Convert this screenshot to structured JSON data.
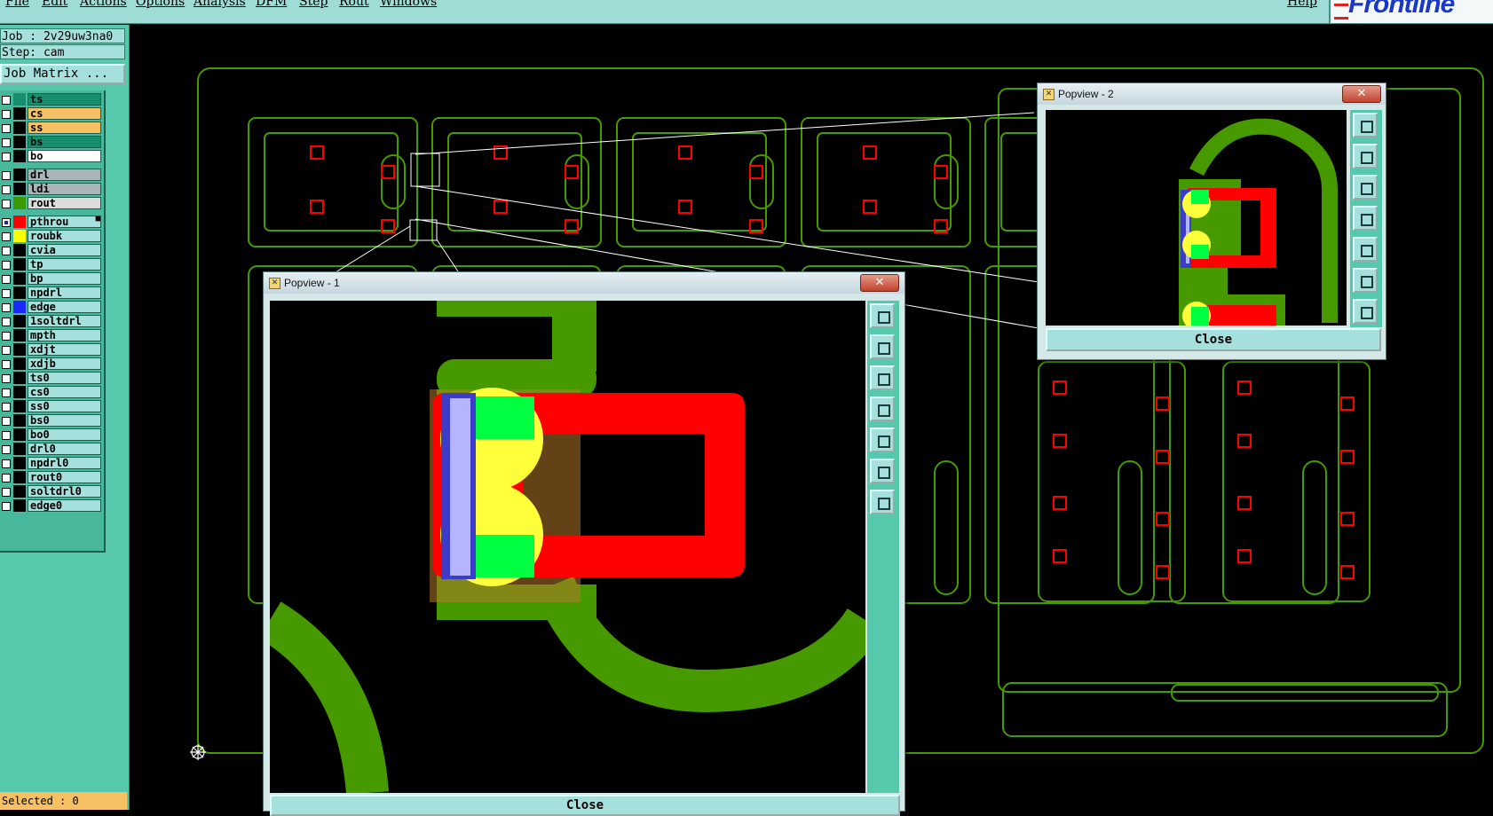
{
  "menubar": {
    "items": [
      "File",
      "Edit",
      "Actions",
      "Options",
      "Analysis",
      "DFM",
      "Step",
      "Rout",
      "Windows"
    ],
    "help": "Help",
    "logo": "Frontline"
  },
  "left_panel": {
    "job": "Job : 2v29uw3na0",
    "step": "Step: cam",
    "job_matrix_button": "Job Matrix ...",
    "selected": "Selected : 0",
    "layers": [
      {
        "name": "ts",
        "color": "#178f6e",
        "bg": "#178f6e",
        "checked": false
      },
      {
        "name": "cs",
        "color": "#000000",
        "bg": "#f7c063",
        "checked": false
      },
      {
        "name": "ss",
        "color": "#000000",
        "bg": "#f7c063",
        "checked": false
      },
      {
        "name": "bs",
        "color": "#000000",
        "bg": "#178f6e",
        "checked": false
      },
      {
        "name": "bo",
        "color": "#000000",
        "bg": "#ffffff",
        "checked": false
      },
      {
        "name": "drl",
        "color": "#000000",
        "bg": "#a8b4b8",
        "checked": false,
        "gap": true
      },
      {
        "name": "ldi",
        "color": "#000000",
        "bg": "#a8b4b8",
        "checked": false
      },
      {
        "name": "rout",
        "color": "#3a9a00",
        "bg": "#dcdcdc",
        "checked": false
      },
      {
        "name": "pthrou",
        "color": "#ff0000",
        "bg": "#a6e0dc",
        "checked": true,
        "mark": "■",
        "gap": true
      },
      {
        "name": "roubk",
        "color": "#ffff00",
        "bg": "#a6e0dc",
        "checked": false
      },
      {
        "name": "cvia",
        "color": "#000000",
        "bg": "#a6e0dc",
        "checked": false
      },
      {
        "name": "tp",
        "color": "#000000",
        "bg": "#a6e0dc",
        "checked": false
      },
      {
        "name": "bp",
        "color": "#000000",
        "bg": "#a6e0dc",
        "checked": false
      },
      {
        "name": "npdrl",
        "color": "#000000",
        "bg": "#a6e0dc",
        "checked": false
      },
      {
        "name": "edge",
        "color": "#1a2aff",
        "bg": "#a6e0dc",
        "checked": false
      },
      {
        "name": "1soltdrl",
        "color": "#000000",
        "bg": "#a6e0dc",
        "checked": false
      },
      {
        "name": "mpth",
        "color": "#000000",
        "bg": "#a6e0dc",
        "checked": false
      },
      {
        "name": "xdjt",
        "color": "#000000",
        "bg": "#a6e0dc",
        "checked": false
      },
      {
        "name": "xdjb",
        "color": "#000000",
        "bg": "#a6e0dc",
        "checked": false
      },
      {
        "name": "ts0",
        "color": "#000000",
        "bg": "#a6e0dc",
        "checked": false
      },
      {
        "name": "cs0",
        "color": "#000000",
        "bg": "#a6e0dc",
        "checked": false
      },
      {
        "name": "ss0",
        "color": "#000000",
        "bg": "#a6e0dc",
        "checked": false
      },
      {
        "name": "bs0",
        "color": "#000000",
        "bg": "#a6e0dc",
        "checked": false
      },
      {
        "name": "bo0",
        "color": "#000000",
        "bg": "#a6e0dc",
        "checked": false
      },
      {
        "name": "drl0",
        "color": "#000000",
        "bg": "#a6e0dc",
        "checked": false
      },
      {
        "name": "npdrl0",
        "color": "#000000",
        "bg": "#a6e0dc",
        "checked": false
      },
      {
        "name": "rout0",
        "color": "#000000",
        "bg": "#a6e0dc",
        "checked": false
      },
      {
        "name": "soltdrl0",
        "color": "#000000",
        "bg": "#a6e0dc",
        "checked": false
      },
      {
        "name": "edge0",
        "color": "#000000",
        "bg": "#a6e0dc",
        "checked": false
      }
    ]
  },
  "popview1": {
    "title": "Popview - 1",
    "close_x": "✕",
    "close_button": "Close"
  },
  "popview2": {
    "title": "Popview - 2",
    "close_x": "✕",
    "close_button": "Close"
  },
  "colors": {
    "rout": "#469a00",
    "pthrou": "#ff0000",
    "roubk": "#ffff3c",
    "pad_green": "#00ff40",
    "edge": "#3c3cc8"
  },
  "toolbar_icons": [
    "zoom-window-icon",
    "zoom-in-icon",
    "zoom-out-icon",
    "pan-left-icon",
    "pan-right-icon",
    "fit-screen-icon",
    "center-icon"
  ]
}
